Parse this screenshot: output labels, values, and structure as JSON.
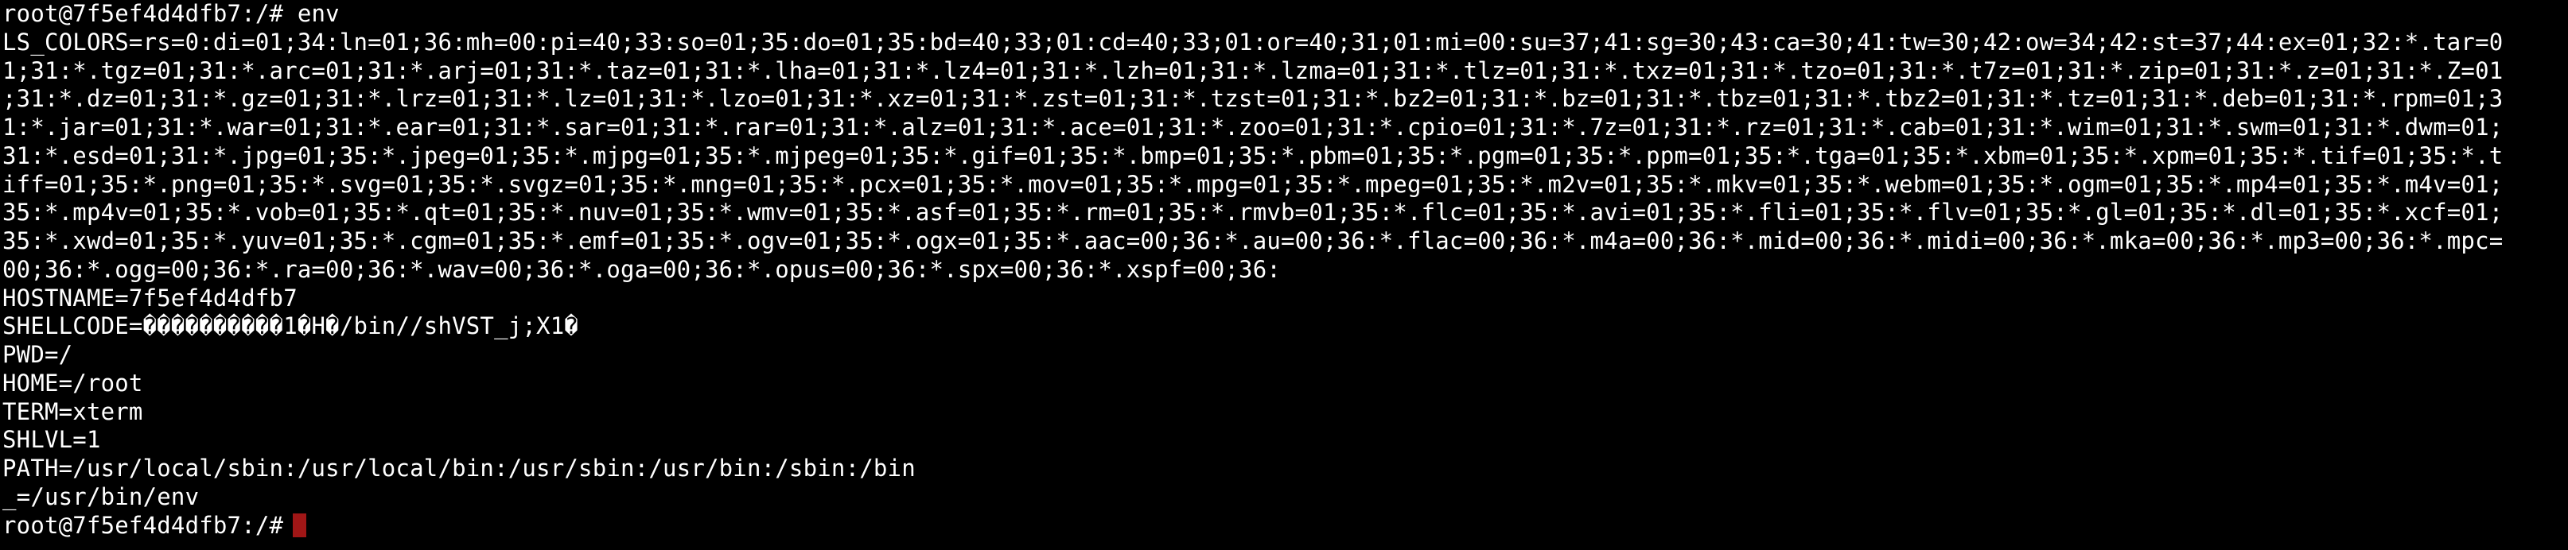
{
  "terminal": {
    "background": "#000000",
    "foreground": "#ffffff",
    "cursor_color": "#a01616",
    "lines": [
      "root@7f5ef4d4dfb7:/# env",
      "LS_COLORS=rs=0:di=01;34:ln=01;36:mh=00:pi=40;33:so=01;35:do=01;35:bd=40;33;01:cd=40;33;01:or=40;31;01:mi=00:su=37;41:sg=30;43:ca=30;41:tw=30;42:ow=34;42:st=37;44:ex=01;32:*.tar=0",
      "1;31:*.tgz=01;31:*.arc=01;31:*.arj=01;31:*.taz=01;31:*.lha=01;31:*.lz4=01;31:*.lzh=01;31:*.lzma=01;31:*.tlz=01;31:*.txz=01;31:*.tzo=01;31:*.t7z=01;31:*.zip=01;31:*.z=01;31:*.Z=01",
      ";31:*.dz=01;31:*.gz=01;31:*.lrz=01;31:*.lz=01;31:*.lzo=01;31:*.xz=01;31:*.zst=01;31:*.tzst=01;31:*.bz2=01;31:*.bz=01;31:*.tbz=01;31:*.tbz2=01;31:*.tz=01;31:*.deb=01;31:*.rpm=01;3",
      "1:*.jar=01;31:*.war=01;31:*.ear=01;31:*.sar=01;31:*.rar=01;31:*.alz=01;31:*.ace=01;31:*.zoo=01;31:*.cpio=01;31:*.7z=01;31:*.rz=01;31:*.cab=01;31:*.wim=01;31:*.swm=01;31:*.dwm=01;",
      "31:*.esd=01;31:*.jpg=01;35:*.jpeg=01;35:*.mjpg=01;35:*.mjpeg=01;35:*.gif=01;35:*.bmp=01;35:*.pbm=01;35:*.pgm=01;35:*.ppm=01;35:*.tga=01;35:*.xbm=01;35:*.xpm=01;35:*.tif=01;35:*.t",
      "iff=01;35:*.png=01;35:*.svg=01;35:*.svgz=01;35:*.mng=01;35:*.pcx=01;35:*.mov=01;35:*.mpg=01;35:*.mpeg=01;35:*.m2v=01;35:*.mkv=01;35:*.webm=01;35:*.ogm=01;35:*.mp4=01;35:*.m4v=01;",
      "35:*.mp4v=01;35:*.vob=01;35:*.qt=01;35:*.nuv=01;35:*.wmv=01;35:*.asf=01;35:*.rm=01;35:*.rmvb=01;35:*.flc=01;35:*.avi=01;35:*.fli=01;35:*.flv=01;35:*.gl=01;35:*.dl=01;35:*.xcf=01;",
      "35:*.xwd=01;35:*.yuv=01;35:*.cgm=01;35:*.emf=01;35:*.ogv=01;35:*.ogx=01;35:*.aac=00;36:*.au=00;36:*.flac=00;36:*.m4a=00;36:*.mid=00;36:*.midi=00;36:*.mka=00;36:*.mp3=00;36:*.mpc=",
      "00;36:*.ogg=00;36:*.ra=00;36:*.wav=00;36:*.oga=00;36:*.opus=00;36:*.spx=00;36:*.xspf=00;36:",
      "HOSTNAME=7f5ef4d4dfb7",
      "SHELLCODE=����������1�H�/bin//shVST_j;X1�",
      "PWD=/",
      "HOME=/root",
      "TERM=xterm",
      "SHLVL=1",
      "PATH=/usr/local/sbin:/usr/local/bin:/usr/sbin:/usr/bin:/sbin:/bin",
      "_=/usr/bin/env",
      "root@7f5ef4d4dfb7:/#"
    ]
  }
}
